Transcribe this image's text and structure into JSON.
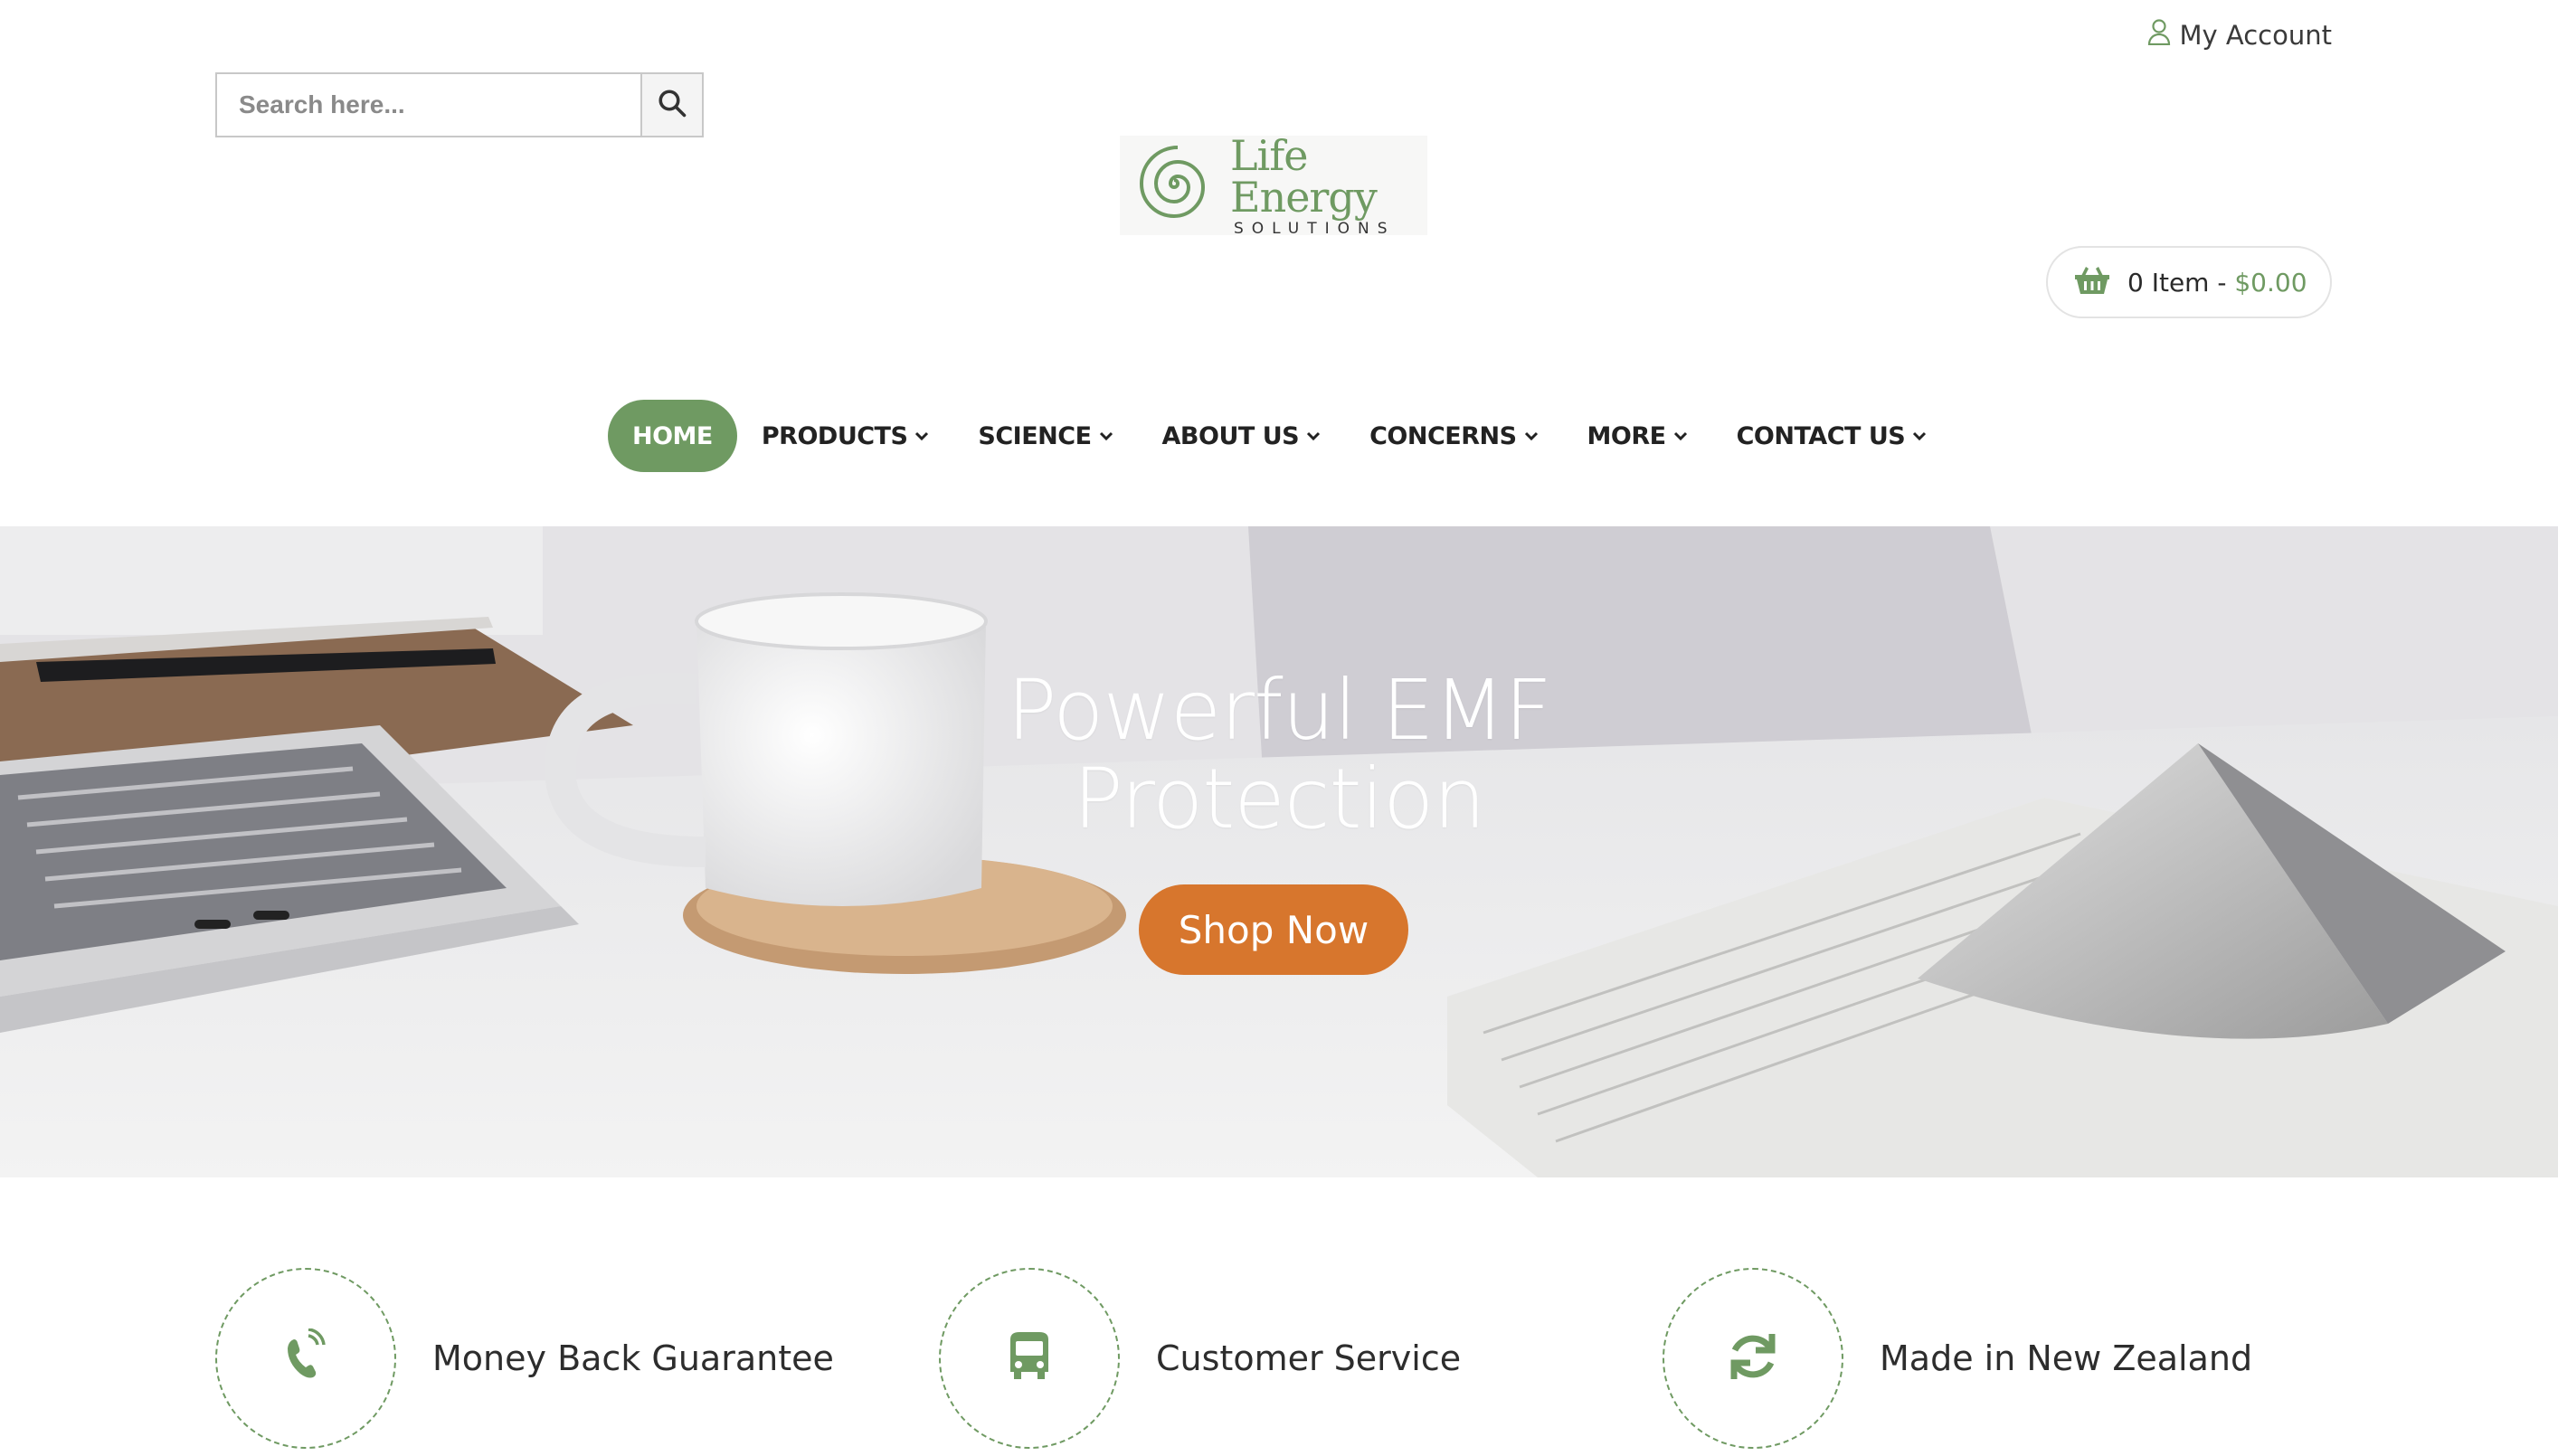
{
  "header": {
    "account_label": "My Account",
    "account_icon": "user-icon",
    "search": {
      "placeholder": "Search here...",
      "icon": "search-icon"
    },
    "logo": {
      "brand": "Life Energy",
      "tagline": "SOLUTIONS"
    },
    "cart": {
      "count_label": "0 Item",
      "separator": " - ",
      "total": "$0.00",
      "icon": "basket-icon"
    }
  },
  "nav": {
    "items": [
      {
        "label": "HOME",
        "active": true,
        "dropdown": false
      },
      {
        "label": "PRODUCTS",
        "dropdown": true
      },
      {
        "label": "SCIENCE",
        "dropdown": true
      },
      {
        "label": "ABOUT US",
        "dropdown": true
      },
      {
        "label": "CONCERNS",
        "dropdown": true
      },
      {
        "label": "MORE",
        "dropdown": true
      },
      {
        "label": "CONTACT US",
        "dropdown": true
      }
    ]
  },
  "hero": {
    "title_line1": "Powerful EMF",
    "title_line2": "Protection",
    "cta_label": "Shop Now"
  },
  "features": [
    {
      "label": "Money Back Guarantee",
      "icon": "phone-icon"
    },
    {
      "label": "Customer Service",
      "icon": "bus-icon"
    },
    {
      "label": "Made in New Zealand",
      "icon": "refresh-icon"
    }
  ],
  "colors": {
    "accent_green": "#6f9a62",
    "cta_orange": "#d7762d",
    "text_dark": "#222222"
  }
}
